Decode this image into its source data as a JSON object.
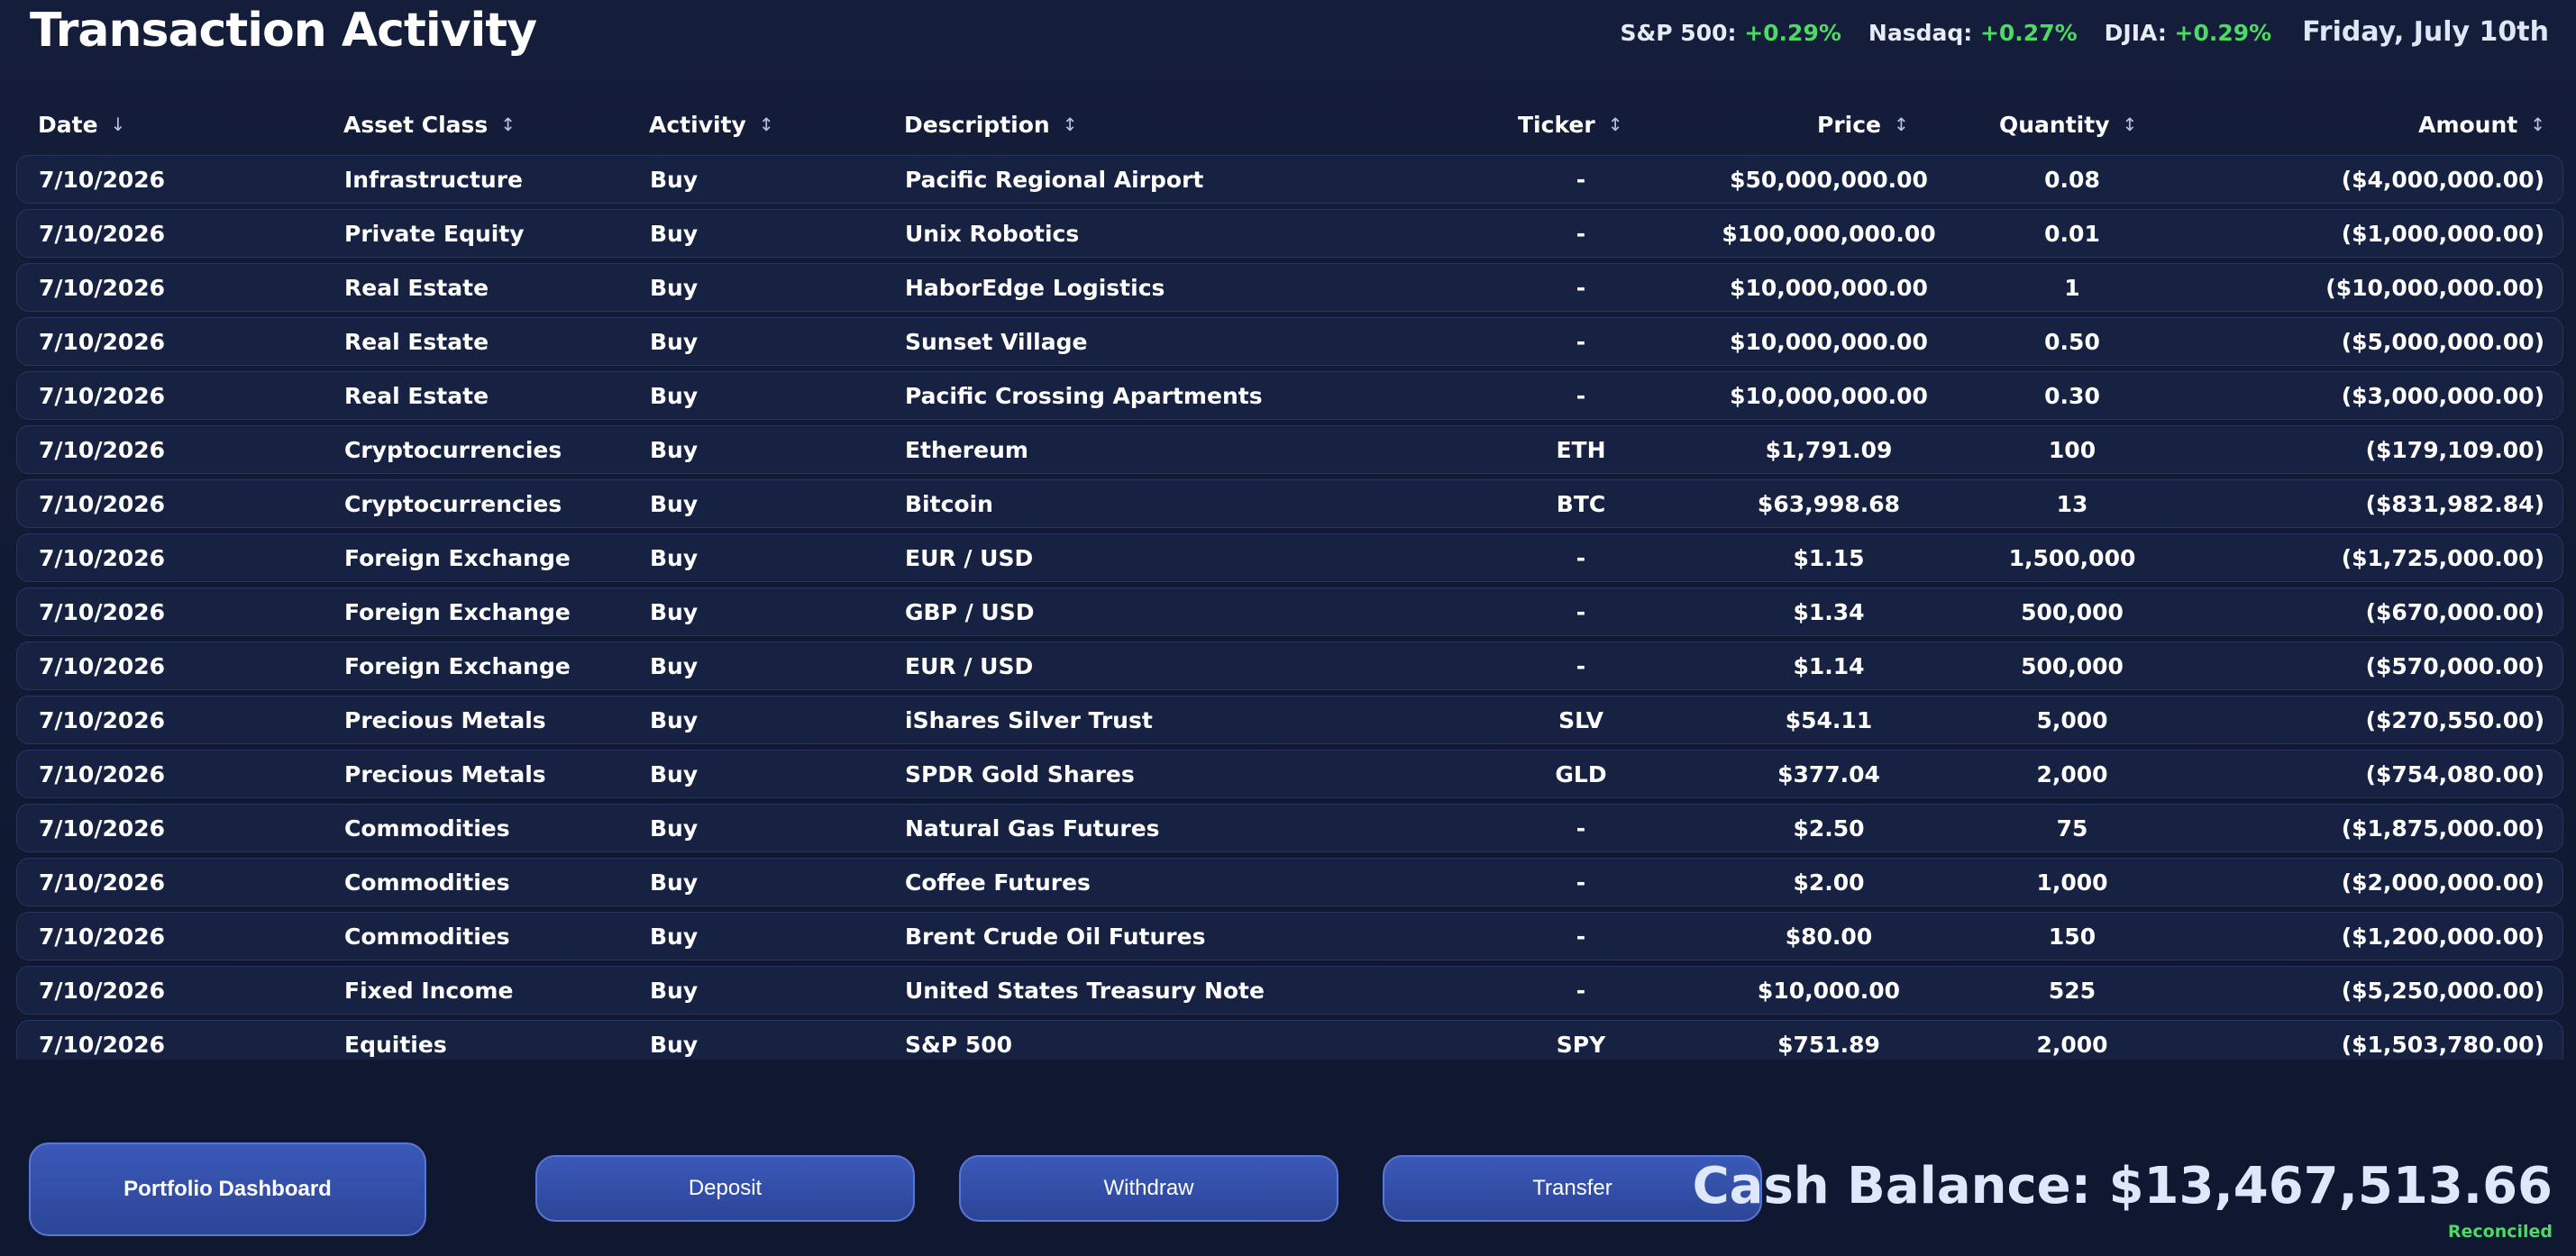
{
  "page_title": "Transaction Activity",
  "market": {
    "indices": [
      {
        "name": "S&P 500:",
        "change": "+0.29%"
      },
      {
        "name": "Nasdaq:",
        "change": "+0.27%"
      },
      {
        "name": "DJIA:",
        "change": "+0.29%"
      }
    ],
    "date": "Friday, July 10th"
  },
  "columns": {
    "date": "Date",
    "asset_class": "Asset Class",
    "activity": "Activity",
    "description": "Description",
    "ticker": "Ticker",
    "price": "Price",
    "quantity": "Quantity",
    "amount": "Amount"
  },
  "sort_icons": {
    "active": "↓",
    "inactive": "↕"
  },
  "transactions": [
    {
      "date": "7/10/2026",
      "asset_class": "Infrastructure",
      "activity": "Buy",
      "description": "Pacific Regional Airport",
      "ticker": "-",
      "price": "$50,000,000.00",
      "quantity": "0.08",
      "amount": "($4,000,000.00)"
    },
    {
      "date": "7/10/2026",
      "asset_class": "Private Equity",
      "activity": "Buy",
      "description": "Unix Robotics",
      "ticker": "-",
      "price": "$100,000,000.00",
      "quantity": "0.01",
      "amount": "($1,000,000.00)"
    },
    {
      "date": "7/10/2026",
      "asset_class": "Real Estate",
      "activity": "Buy",
      "description": "HaborEdge Logistics",
      "ticker": "-",
      "price": "$10,000,000.00",
      "quantity": "1",
      "amount": "($10,000,000.00)"
    },
    {
      "date": "7/10/2026",
      "asset_class": "Real Estate",
      "activity": "Buy",
      "description": "Sunset Village",
      "ticker": "-",
      "price": "$10,000,000.00",
      "quantity": "0.50",
      "amount": "($5,000,000.00)"
    },
    {
      "date": "7/10/2026",
      "asset_class": "Real Estate",
      "activity": "Buy",
      "description": "Pacific Crossing Apartments",
      "ticker": "-",
      "price": "$10,000,000.00",
      "quantity": "0.30",
      "amount": "($3,000,000.00)"
    },
    {
      "date": "7/10/2026",
      "asset_class": "Cryptocurrencies",
      "activity": "Buy",
      "description": "Ethereum",
      "ticker": "ETH",
      "price": "$1,791.09",
      "quantity": "100",
      "amount": "($179,109.00)"
    },
    {
      "date": "7/10/2026",
      "asset_class": "Cryptocurrencies",
      "activity": "Buy",
      "description": "Bitcoin",
      "ticker": "BTC",
      "price": "$63,998.68",
      "quantity": "13",
      "amount": "($831,982.84)"
    },
    {
      "date": "7/10/2026",
      "asset_class": "Foreign Exchange",
      "activity": "Buy",
      "description": "EUR / USD",
      "ticker": "-",
      "price": "$1.15",
      "quantity": "1,500,000",
      "amount": "($1,725,000.00)"
    },
    {
      "date": "7/10/2026",
      "asset_class": "Foreign Exchange",
      "activity": "Buy",
      "description": "GBP / USD",
      "ticker": "-",
      "price": "$1.34",
      "quantity": "500,000",
      "amount": "($670,000.00)"
    },
    {
      "date": "7/10/2026",
      "asset_class": "Foreign Exchange",
      "activity": "Buy",
      "description": "EUR / USD",
      "ticker": "-",
      "price": "$1.14",
      "quantity": "500,000",
      "amount": "($570,000.00)"
    },
    {
      "date": "7/10/2026",
      "asset_class": "Precious Metals",
      "activity": "Buy",
      "description": "iShares Silver Trust",
      "ticker": "SLV",
      "price": "$54.11",
      "quantity": "5,000",
      "amount": "($270,550.00)"
    },
    {
      "date": "7/10/2026",
      "asset_class": "Precious Metals",
      "activity": "Buy",
      "description": "SPDR Gold Shares",
      "ticker": "GLD",
      "price": "$377.04",
      "quantity": "2,000",
      "amount": "($754,080.00)"
    },
    {
      "date": "7/10/2026",
      "asset_class": "Commodities",
      "activity": "Buy",
      "description": "Natural Gas Futures",
      "ticker": "-",
      "price": "$2.50",
      "quantity": "75",
      "amount": "($1,875,000.00)"
    },
    {
      "date": "7/10/2026",
      "asset_class": "Commodities",
      "activity": "Buy",
      "description": "Coffee Futures",
      "ticker": "-",
      "price": "$2.00",
      "quantity": "1,000",
      "amount": "($2,000,000.00)"
    },
    {
      "date": "7/10/2026",
      "asset_class": "Commodities",
      "activity": "Buy",
      "description": "Brent Crude Oil Futures",
      "ticker": "-",
      "price": "$80.00",
      "quantity": "150",
      "amount": "($1,200,000.00)"
    },
    {
      "date": "7/10/2026",
      "asset_class": "Fixed Income",
      "activity": "Buy",
      "description": "United States Treasury Note",
      "ticker": "-",
      "price": "$10,000.00",
      "quantity": "525",
      "amount": "($5,250,000.00)"
    },
    {
      "date": "7/10/2026",
      "asset_class": "Equities",
      "activity": "Buy",
      "description": "S&P 500",
      "ticker": "SPY",
      "price": "$751.89",
      "quantity": "2,000",
      "amount": "($1,503,780.00)"
    }
  ],
  "buttons": {
    "portfolio_dashboard": "Portfolio Dashboard",
    "deposit": "Deposit",
    "withdraw": "Withdraw",
    "transfer": "Transfer"
  },
  "cash_balance": {
    "label": "Cash Balance:",
    "value": "$13,467,513.66",
    "status": "Reconciled"
  },
  "colors": {
    "background": "#111a33",
    "row_background": "#172243",
    "positive": "#4cd964",
    "button": "#3a59b8"
  }
}
